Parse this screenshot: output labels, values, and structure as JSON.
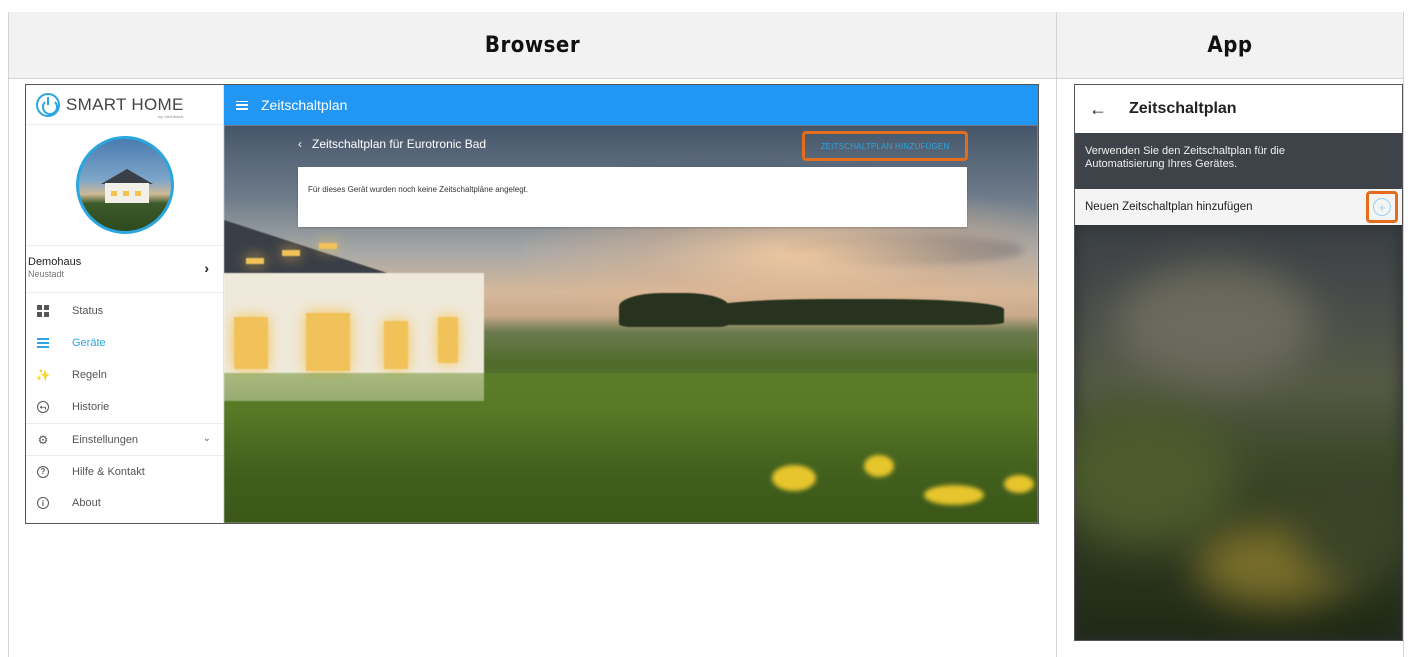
{
  "table": {
    "browser_header": "Browser",
    "app_header": "App"
  },
  "browser": {
    "logo": {
      "text": "SMART HOME",
      "sub": "by hornbach"
    },
    "home": {
      "name": "Demohaus",
      "location": "Neustadt"
    },
    "nav": [
      {
        "label": "Status",
        "icon": "dashboard-icon"
      },
      {
        "label": "Geräte",
        "icon": "devices-list-icon",
        "active": true
      },
      {
        "label": "Regeln",
        "icon": "magic-wand-icon"
      },
      {
        "label": "Historie",
        "icon": "history-icon"
      },
      {
        "label": "Einstellungen",
        "icon": "gear-icon"
      },
      {
        "label": "Hilfe & Kontakt",
        "icon": "help-icon"
      },
      {
        "label": "About",
        "icon": "info-icon"
      }
    ],
    "topbar_title": "Zeitschaltplan",
    "subtitle": "Zeitschaltplan für Eurotronic Bad",
    "add_button": "ZEITSCHALTPLAN HINZUFÜGEN",
    "empty_message": "Für dieses Gerät wurden noch keine Zeitschaltpläne angelegt."
  },
  "app": {
    "title": "Zeitschaltplan",
    "description_line1": "Verwenden Sie den Zeitschaltplan für die",
    "description_line2": "Automatisierung Ihres Gerätes.",
    "add_label": "Neuen Zeitschaltplan hinzufügen"
  },
  "colors": {
    "accent": "#2196f3",
    "highlight": "#e36c1d",
    "link": "#2aa6e0"
  }
}
